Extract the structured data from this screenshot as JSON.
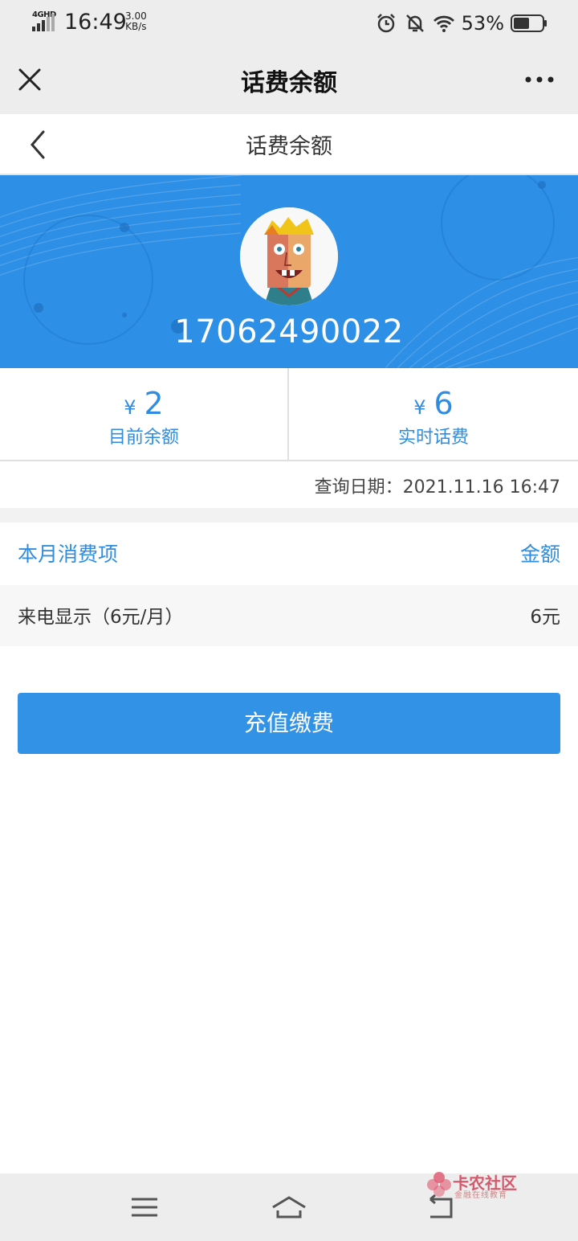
{
  "status_bar": {
    "network": "4GHD",
    "time": "16:49",
    "speed_value": "3.00",
    "speed_unit": "KB/s",
    "battery": "53%",
    "icons": [
      "alarm-icon",
      "mute-bell-icon",
      "wifi-icon",
      "battery-icon"
    ]
  },
  "titlebar": {
    "title": "话费余额",
    "close_icon": "close-icon",
    "more_icon": "more-dots-icon"
  },
  "page_header": {
    "title": "话费余额",
    "back_icon": "chevron-left-icon"
  },
  "hero": {
    "phone_number": "17062490022",
    "background_color": "#2d8fe5"
  },
  "balances": [
    {
      "currency": "¥",
      "amount": "2",
      "label": "目前余额"
    },
    {
      "currency": "¥",
      "amount": "6",
      "label": "实时话费"
    }
  ],
  "query": {
    "label": "查询日期：",
    "value": "2021.11.16 16:47"
  },
  "list": {
    "header_item": "本月消费项",
    "header_amount": "金额",
    "rows": [
      {
        "item": "来电显示（6元/月）",
        "amount": "6元"
      }
    ]
  },
  "pay_button": {
    "label": "充值缴费",
    "color": "#3292e6"
  },
  "accent_color": "#2e8de0",
  "watermark": {
    "title": "卡农社区",
    "subtitle": "金融在线教育"
  },
  "navbar": {
    "icons": [
      "menu-icon",
      "home-icon",
      "back-icon"
    ]
  }
}
